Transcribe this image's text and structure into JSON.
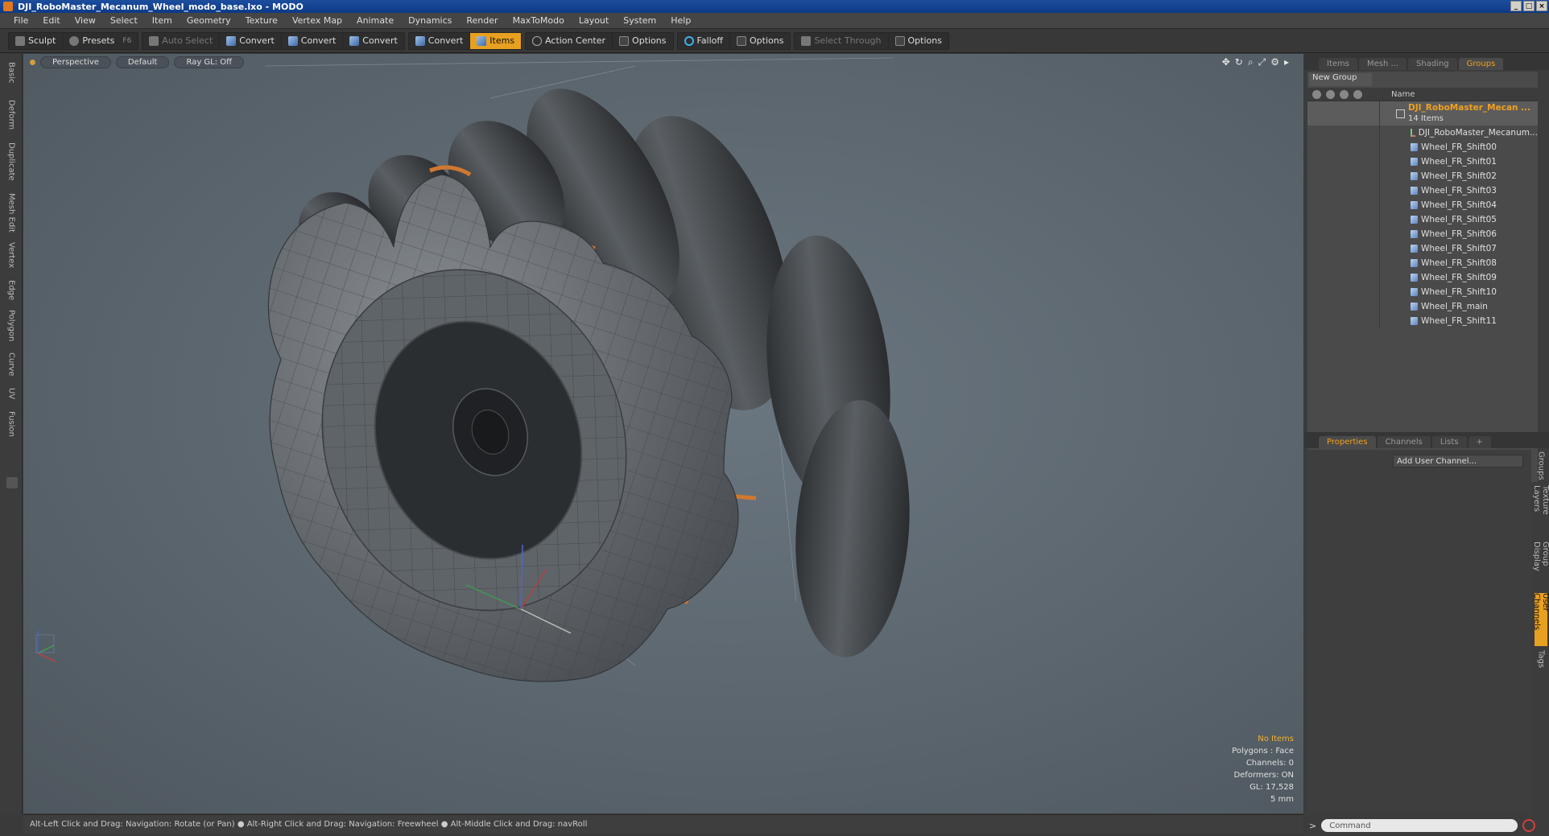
{
  "window": {
    "title": "DJI_RoboMaster_Mecanum_Wheel_modo_base.lxo - MODO",
    "controls": [
      "_",
      "□",
      "×"
    ]
  },
  "menu": [
    "File",
    "Edit",
    "View",
    "Select",
    "Item",
    "Geometry",
    "Texture",
    "Vertex Map",
    "Animate",
    "Dynamics",
    "Render",
    "MaxToModo",
    "Layout",
    "System",
    "Help"
  ],
  "toolbar": {
    "sculpt": "Sculpt",
    "presets": "Presets",
    "presets_hotkey": "F6",
    "auto_select": "Auto Select",
    "convert1": "Convert",
    "convert2": "Convert",
    "convert3": "Convert",
    "convert4": "Convert",
    "items": "Items",
    "action_center": "Action Center",
    "options1": "Options",
    "falloff": "Falloff",
    "options2": "Options",
    "select_through": "Select Through",
    "options3": "Options"
  },
  "left_tabs": [
    "Basic",
    "Deform",
    "Duplicate",
    "Mesh Edit",
    "Vertex",
    "Edge",
    "Polygon",
    "Curve",
    "UV",
    "Fusion"
  ],
  "viewport": {
    "view": "Perspective",
    "shading": "Default",
    "raygl": "Ray GL: Off",
    "info": {
      "selection": "No Items",
      "polygons": "Polygons : Face",
      "channels": "Channels: 0",
      "deformers": "Deformers: ON",
      "gl": "GL: 17,528",
      "scale": "5 mm"
    }
  },
  "status": "Alt-Left Click and Drag: Navigation: Rotate (or Pan) ● Alt-Right Click and Drag: Navigation: Freewheel ● Alt-Middle Click and Drag: navRoll",
  "right_panel": {
    "tabs": [
      "Items",
      "Mesh ...",
      "Shading",
      "Groups"
    ],
    "active_tab": "Groups",
    "new_group": "New Group",
    "name_header": "Name",
    "root": {
      "name": "DJI_RoboMaster_Mecan ...",
      "count": "14 Items"
    },
    "items": [
      "DJI_RoboMaster_Mecanum...",
      "Wheel_FR_Shift00",
      "Wheel_FR_Shift01",
      "Wheel_FR_Shift02",
      "Wheel_FR_Shift03",
      "Wheel_FR_Shift04",
      "Wheel_FR_Shift05",
      "Wheel_FR_Shift06",
      "Wheel_FR_Shift07",
      "Wheel_FR_Shift08",
      "Wheel_FR_Shift09",
      "Wheel_FR_Shift10",
      "Wheel_FR_main",
      "Wheel_FR_Shift11"
    ],
    "props_tabs": [
      "Properties",
      "Channels",
      "Lists",
      "+"
    ],
    "add_channel": "Add User Channel...",
    "side_tabs": [
      "Groups",
      "Texture Layers",
      "Group Display",
      "User Channels",
      "Tags"
    ],
    "active_side_tab": "User Channels",
    "command_placeholder": "Command",
    "cmd_prompt": ">"
  },
  "colors": {
    "accent": "#e8a020",
    "title_bar": "#0d3a87",
    "viewport_bg": "#5a646c",
    "rim": "#d07830"
  }
}
